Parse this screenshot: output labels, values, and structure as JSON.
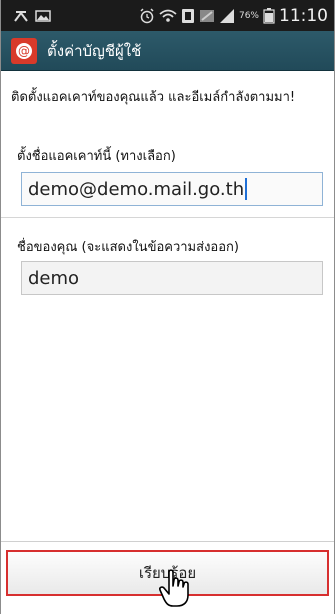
{
  "status_bar": {
    "battery_percent": "76%",
    "time": "11:10",
    "icons": [
      "notification-icon",
      "image-icon",
      "alarm-icon",
      "wifi-icon",
      "nfc-icon",
      "data-icon",
      "signal-icon",
      "battery-icon"
    ]
  },
  "action_bar": {
    "title": "ตั้งค่าบัญชีผู้ใช้",
    "icon": "email-app-icon"
  },
  "form": {
    "intro_text": "ติดตั้งแอคเคาท์ของคุณแล้ว และอีเมล์กำลังตามมา!",
    "account_name_label": "ตั้งชื่อแอคเคาท์นี้ (ทางเลือก)",
    "account_name_value": "demo@demo.mail.go.th",
    "your_name_label": "ชื่อของคุณ (จะแสดงในข้อความส่งออก)",
    "your_name_value": "demo"
  },
  "footer": {
    "done_label": "เรียบร้อย"
  },
  "colors": {
    "action_bar": "#214a59",
    "highlight_border": "#d72f2f",
    "status_bar": "#1b1b1b"
  }
}
